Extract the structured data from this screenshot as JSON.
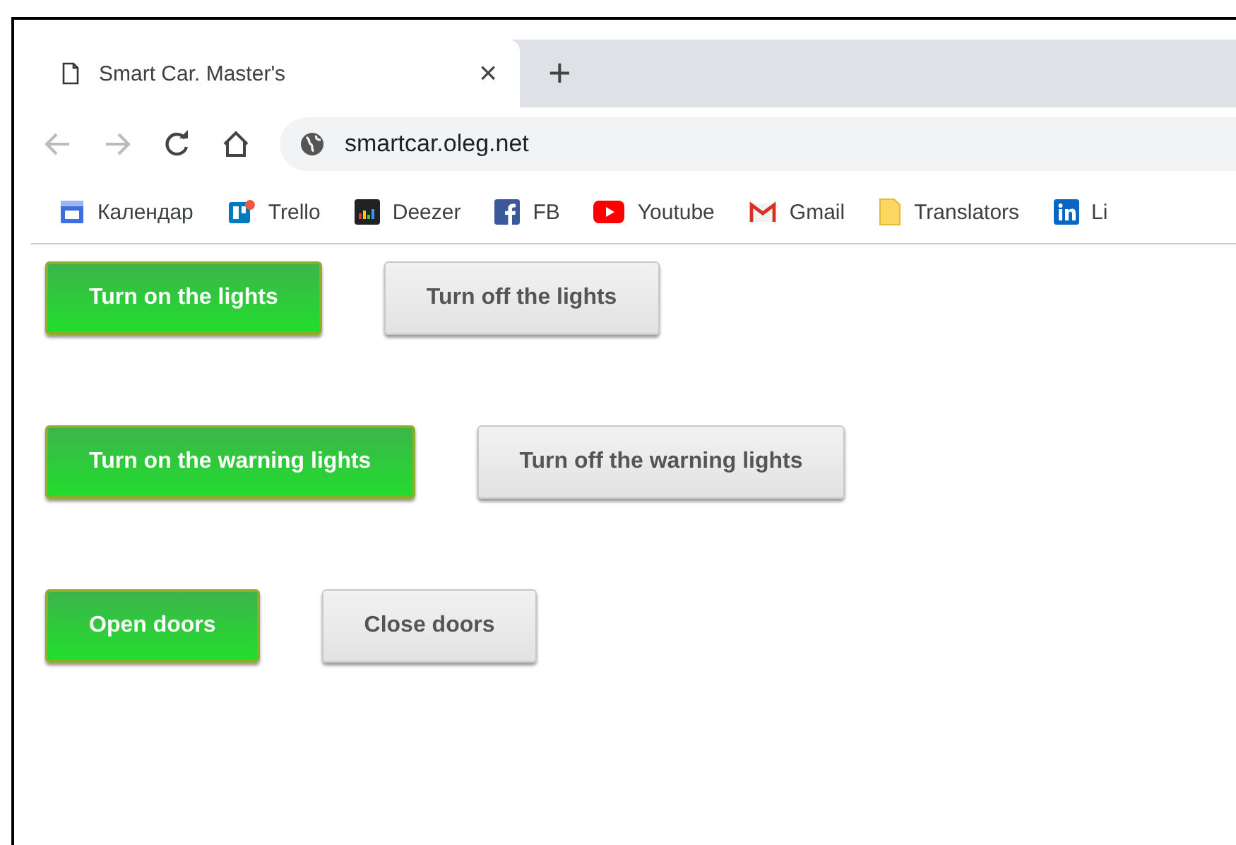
{
  "tab": {
    "title": "Smart Car. Master's",
    "close": "×"
  },
  "new_tab": "+",
  "address": {
    "url": "smartcar.oleg.net"
  },
  "bookmarks": [
    {
      "kind": "calendar",
      "label": "Календар"
    },
    {
      "kind": "trello",
      "label": "Trello"
    },
    {
      "kind": "deezer",
      "label": "Deezer"
    },
    {
      "kind": "facebook",
      "label": "FB"
    },
    {
      "kind": "youtube",
      "label": "Youtube"
    },
    {
      "kind": "gmail",
      "label": "Gmail"
    },
    {
      "kind": "folder",
      "label": "Translators"
    },
    {
      "kind": "linkedin",
      "label": "Li"
    }
  ],
  "button_rows": [
    [
      {
        "kind": "on",
        "label": "Turn on the lights"
      },
      {
        "kind": "off",
        "label": "Turn off the lights"
      }
    ],
    [
      {
        "kind": "on",
        "label": "Turn on the warning lights"
      },
      {
        "kind": "off",
        "label": "Turn off the warning lights"
      }
    ],
    [
      {
        "kind": "on",
        "label": "Open doors"
      },
      {
        "kind": "off",
        "label": "Close doors"
      }
    ]
  ]
}
